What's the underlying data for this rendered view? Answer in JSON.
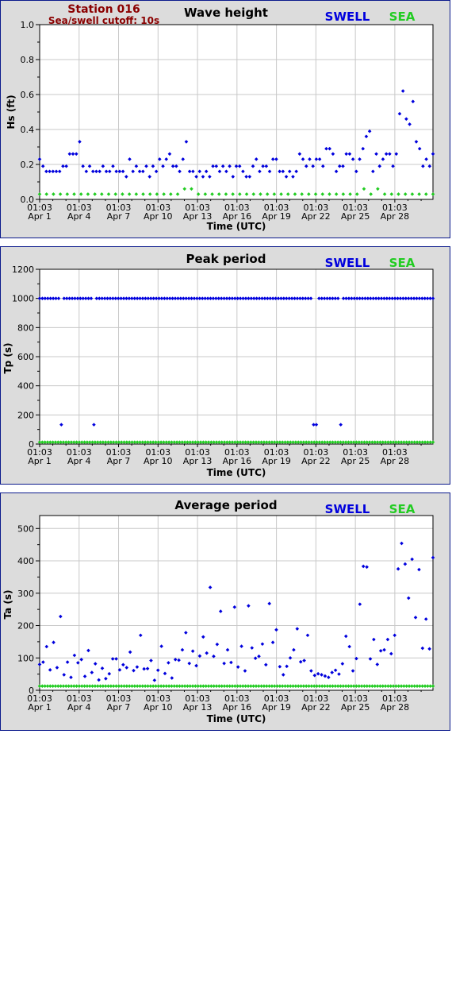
{
  "station": {
    "name": "Station 016",
    "cutoff": "Sea/swell cutoff: 10s"
  },
  "colors": {
    "swell": "#0000dd",
    "sea": "#22cc22",
    "frame": "#0b1a8c",
    "panel_bg": "#dcdcdc",
    "plot_bg": "#ffffff",
    "grid": "#c8c8c8"
  },
  "chart_data": [
    {
      "type": "scatter",
      "title": "Wave height",
      "ylabel": "Hs (ft)",
      "xlabel": "Time (UTC)",
      "ylim": [
        0,
        1.0
      ],
      "yticks": [
        "0.0",
        "0.2",
        "0.4",
        "0.6",
        "0.8",
        "1.0"
      ],
      "x_days": [
        1,
        30.9
      ],
      "xticks": [
        {
          "day": 1,
          "time": "01:03",
          "date": "Apr 1"
        },
        {
          "day": 4,
          "time": "01:03",
          "date": "Apr 4"
        },
        {
          "day": 7,
          "time": "01:03",
          "date": "Apr 7"
        },
        {
          "day": 10,
          "time": "01:03",
          "date": "Apr 10"
        },
        {
          "day": 13,
          "time": "01:03",
          "date": "Apr 13"
        },
        {
          "day": 16,
          "time": "01:03",
          "date": "Apr 16"
        },
        {
          "day": 19,
          "time": "01:03",
          "date": "Apr 19"
        },
        {
          "day": 22,
          "time": "01:03",
          "date": "Apr 22"
        },
        {
          "day": 25,
          "time": "01:03",
          "date": "Apr 25"
        },
        {
          "day": 28,
          "time": "01:03",
          "date": "Apr 28"
        }
      ],
      "grid": true,
      "legend": "top-right",
      "series": [
        {
          "name": "SWELL",
          "values": [
            0.23,
            0.19,
            0.16,
            0.16,
            0.16,
            0.16,
            0.16,
            0.19,
            0.19,
            0.26,
            0.26,
            0.26,
            0.33,
            0.19,
            0.16,
            0.19,
            0.16,
            0.16,
            0.16,
            0.19,
            0.16,
            0.16,
            0.19,
            0.16,
            0.16,
            0.16,
            0.13,
            0.23,
            0.16,
            0.19,
            0.16,
            0.16,
            0.19,
            0.13,
            0.19,
            0.16,
            0.23,
            0.19,
            0.23,
            0.26,
            0.19,
            0.19,
            0.16,
            0.23,
            0.33,
            0.16,
            0.16,
            0.13,
            0.16,
            0.13,
            0.16,
            0.13,
            0.19,
            0.19,
            0.16,
            0.19,
            0.16,
            0.19,
            0.13,
            0.19,
            0.19,
            0.16,
            0.13,
            0.13,
            0.19,
            0.23,
            0.16,
            0.19,
            0.19,
            0.16,
            0.23,
            0.23,
            0.16,
            0.16,
            0.13,
            0.16,
            0.13,
            0.16,
            0.26,
            0.23,
            0.19,
            0.23,
            0.19,
            0.23,
            0.23,
            0.19,
            0.29,
            0.29,
            0.26,
            0.16,
            0.19,
            0.19,
            0.26,
            0.26,
            0.23,
            0.16,
            0.23,
            0.29,
            0.36,
            0.39,
            0.16,
            0.26,
            0.19,
            0.23,
            0.26,
            0.26,
            0.19,
            0.26,
            0.49,
            0.62,
            0.46,
            0.43,
            0.56,
            0.33,
            0.29,
            0.19,
            0.23,
            0.19,
            0.26
          ]
        },
        {
          "name": "SEA",
          "values": [
            0.03,
            0.03,
            0.03,
            0.03,
            0.03,
            0.03,
            0.03,
            0.03,
            0.03,
            0.03,
            0.03,
            0.03,
            0.03,
            0.03,
            0.03,
            0.03,
            0.03,
            0.03,
            0.03,
            0.03,
            0.03,
            0.06,
            0.06,
            0.03,
            0.03,
            0.03,
            0.03,
            0.03,
            0.03,
            0.03,
            0.03,
            0.03,
            0.03,
            0.03,
            0.03,
            0.03,
            0.03,
            0.03,
            0.03,
            0.03,
            0.03,
            0.03,
            0.03,
            0.03,
            0.03,
            0.03,
            0.03,
            0.06,
            0.03,
            0.06,
            0.03,
            0.03,
            0.03,
            0.03,
            0.03,
            0.03,
            0.03,
            0.03
          ]
        }
      ]
    },
    {
      "type": "scatter",
      "title": "Peak period",
      "ylabel": "Tp (s)",
      "xlabel": "Time (UTC)",
      "ylim": [
        0,
        1200
      ],
      "yticks": [
        "0",
        "200",
        "400",
        "600",
        "800",
        "1000",
        "1200"
      ],
      "grid": true,
      "legend": "top-right",
      "series": [
        {
          "name": "SWELL",
          "values": [
            1000,
            1000,
            1000,
            1000,
            1000,
            1000,
            1000,
            1000,
            133,
            1000,
            1000,
            1000,
            1000,
            1000,
            1000,
            1000,
            1000,
            1000,
            1000,
            1000,
            133,
            1000,
            1000,
            1000,
            1000,
            1000,
            1000,
            1000,
            1000,
            1000,
            1000,
            1000,
            1000,
            1000,
            1000,
            1000,
            1000,
            1000,
            1000,
            1000,
            1000,
            1000,
            1000,
            1000,
            1000,
            1000,
            1000,
            1000,
            1000,
            1000,
            1000,
            1000,
            1000,
            1000,
            1000,
            1000,
            1000,
            1000,
            1000,
            1000,
            1000,
            1000,
            1000,
            1000,
            1000,
            1000,
            1000,
            1000,
            1000,
            1000,
            1000,
            1000,
            1000,
            1000,
            1000,
            1000,
            1000,
            1000,
            1000,
            1000,
            1000,
            1000,
            1000,
            1000,
            1000,
            1000,
            1000,
            1000,
            1000,
            1000,
            1000,
            1000,
            1000,
            1000,
            1000,
            1000,
            1000,
            1000,
            1000,
            1000,
            1000,
            133,
            133,
            1000,
            1000,
            1000,
            1000,
            1000,
            1000,
            1000,
            1000,
            133,
            1000,
            1000,
            1000,
            1000,
            1000,
            1000,
            1000,
            1000,
            1000,
            1000,
            1000,
            1000,
            1000,
            1000,
            1000,
            1000,
            1000,
            1000,
            1000,
            1000,
            1000,
            1000,
            1000,
            1000,
            1000,
            1000,
            1000,
            1000,
            1000,
            1000,
            1000,
            1000,
            1000,
            1000
          ]
        },
        {
          "name": "SEA",
          "values": [
            13
          ]
        }
      ]
    },
    {
      "type": "scatter",
      "title": "Average period",
      "ylabel": "Ta (s)",
      "xlabel": "Time (UTC)",
      "ylim": [
        0,
        540
      ],
      "yticks": [
        "0",
        "100",
        "200",
        "300",
        "400",
        "500"
      ],
      "grid": true,
      "legend": "top-right",
      "series": [
        {
          "name": "SWELL",
          "values": [
            80,
            87,
            135,
            63,
            148,
            70,
            228,
            48,
            87,
            40,
            108,
            85,
            95,
            43,
            123,
            55,
            82,
            32,
            68,
            36,
            51,
            97,
            97,
            63,
            79,
            70,
            118,
            61,
            72,
            170,
            66,
            67,
            92,
            31,
            62,
            136,
            52,
            85,
            38,
            95,
            93,
            125,
            178,
            83,
            121,
            76,
            106,
            165,
            115,
            318,
            105,
            142,
            244,
            83,
            125,
            86,
            257,
            72,
            136,
            60,
            261,
            131,
            99,
            105,
            143,
            79,
            268,
            148,
            187,
            73,
            48,
            74,
            100,
            125,
            190,
            88,
            92,
            170,
            60,
            46,
            51,
            48,
            44,
            40,
            55,
            62,
            50,
            82,
            167,
            135,
            60,
            98,
            266,
            383,
            381,
            97,
            157,
            80,
            122,
            125,
            157,
            113,
            170,
            375,
            454,
            390,
            285,
            405,
            225,
            373,
            130,
            220,
            128,
            410
          ]
        },
        {
          "name": "SEA",
          "values": [
            13
          ]
        }
      ]
    }
  ]
}
